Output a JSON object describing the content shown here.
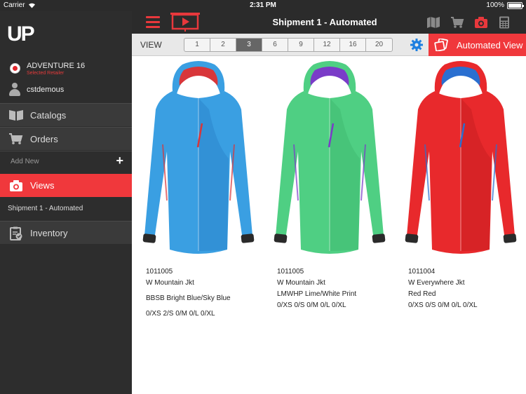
{
  "status_bar": {
    "carrier": "Carrier",
    "time": "2:31 PM",
    "battery": "100%"
  },
  "sidebar": {
    "logo": "UP",
    "retailer_name": "ADVENTURE 16",
    "retailer_sub": "Selected Retailer",
    "user_name": "cstdemous",
    "catalogs": "Catalogs",
    "orders": "Orders",
    "add_new": "Add New",
    "add_new_icon": "+",
    "views": "Views",
    "shipment": "Shipment 1 - Automated",
    "inventory": "Inventory"
  },
  "toolbar": {
    "title": "Shipment 1 - Automated"
  },
  "viewbar": {
    "label": "VIEW",
    "options": [
      "1",
      "2",
      "3",
      "6",
      "9",
      "12",
      "16",
      "20"
    ],
    "selected": "3",
    "automated_view": "Automated View"
  },
  "colors": {
    "accent": "#f0383c",
    "sidebar_bg": "#2d2d2d",
    "toolbar_bg": "#2b2b2b",
    "gear": "#1e7fe0"
  },
  "products": [
    {
      "sku": "1011005",
      "name": "W Mountain Jkt",
      "color": "BBSB Bright Blue/Sky Blue",
      "sizes": "0/XS 2/S 0/M 0/L 0/XL",
      "jacket_main": "#3a9fe2",
      "jacket_dark": "#2a80c8",
      "jacket_hood": "#d8363a"
    },
    {
      "sku": "1011005",
      "name": "W Mountain Jkt",
      "color": "LMWHP Lime/White Print",
      "sizes": "0/XS 0/S 0/M 0/L 0/XL",
      "jacket_main": "#4fcf83",
      "jacket_dark": "#3db56d",
      "jacket_hood": "#7a3cc8"
    },
    {
      "sku": "1011004",
      "name": "W Everywhere Jkt",
      "color": "Red Red",
      "sizes": "0/XS 0/S 0/M 0/L 0/XL",
      "jacket_main": "#e8292c",
      "jacket_dark": "#c41c20",
      "jacket_hood": "#2a6fd0"
    }
  ]
}
